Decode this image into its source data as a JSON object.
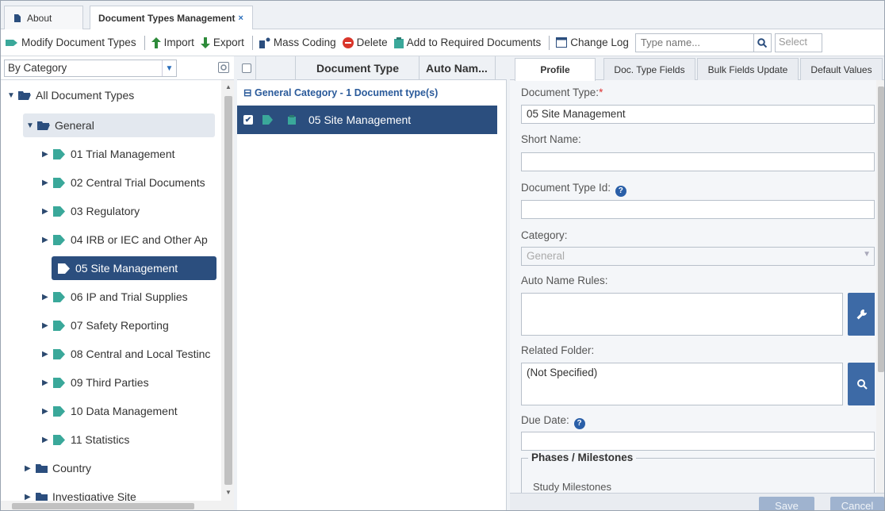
{
  "tabs": [
    {
      "label": "About"
    },
    {
      "label": "Document Types Management",
      "close": "×"
    }
  ],
  "toolbar": {
    "modify": "Modify Document Types",
    "import": "Import",
    "export": "Export",
    "mass_coding": "Mass Coding",
    "delete": "Delete",
    "add_required": "Add to Required Documents",
    "change_log": "Change Log",
    "search_placeholder": "Type name...",
    "select_text": "Select"
  },
  "left": {
    "category_select": "By Category",
    "tree": {
      "root": "All Document Types",
      "general": "General",
      "items": [
        "01 Trial Management",
        "02 Central Trial Documents",
        "03 Regulatory",
        "04 IRB or IEC and Other Ap",
        "05 Site Management",
        "06 IP and Trial Supplies",
        "07 Safety Reporting",
        "08 Central and Local Testinc",
        "09 Third Parties",
        "10 Data Management",
        "11 Statistics"
      ],
      "country": "Country",
      "investigative_site": "Investigative Site"
    }
  },
  "middle": {
    "col_document_type": "Document Type",
    "col_auto_name": "Auto Nam...",
    "group_label": "General Category - 1 Document type(s)",
    "selected_row": "05 Site Management"
  },
  "right": {
    "tabs": [
      "Profile",
      "Doc. Type Fields",
      "Bulk Fields Update",
      "Default Values"
    ],
    "document_type_label": "Document Type:",
    "document_type_value": "05 Site Management",
    "short_name_label": "Short Name:",
    "document_type_id_label": "Document Type Id:",
    "category_label": "Category:",
    "category_value": "General",
    "auto_name_rules_label": "Auto Name Rules:",
    "related_folder_label": "Related Folder:",
    "related_folder_value": "(Not Specified)",
    "due_date_label": "Due Date:",
    "phases_legend": "Phases / Milestones",
    "study_milestones": "Study Milestones",
    "save": "Save",
    "cancel": "Cancel"
  },
  "colors": {
    "accent": "#2b4e7e",
    "tag_green": "#3aa89a",
    "button_blue": "#3d6aa6"
  }
}
